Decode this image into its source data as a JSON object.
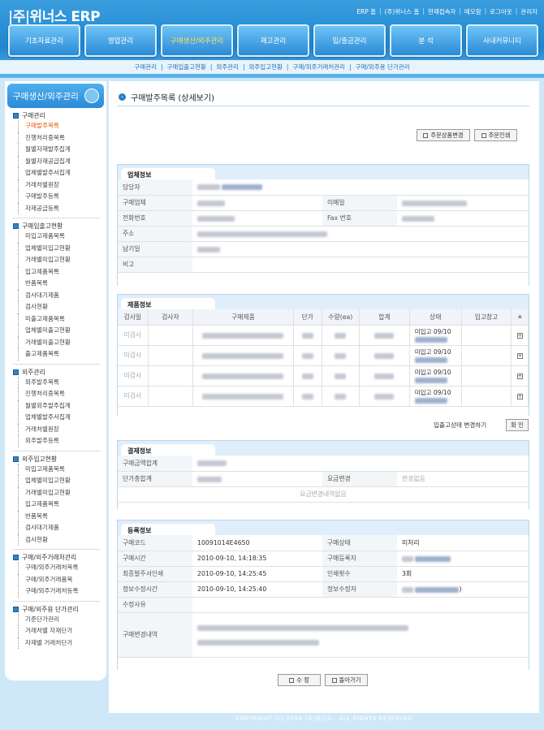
{
  "app": {
    "logo": "|주|위너스 ERP"
  },
  "toplinks": [
    "ERP 홈",
    "(주)위너스 홈",
    "현재접속자",
    "메모함",
    "로그아웃",
    "관리자"
  ],
  "nav": [
    "기초자료관리",
    "영업관리",
    "구매생산/외주관리",
    "재고관리",
    "입/출금관리",
    "분 석",
    "사내커뮤니티"
  ],
  "subnav": [
    "구매관리",
    "구매입출고현황",
    "외주관리",
    "외주입고현황",
    "구매/외주거래처관리",
    "구매/외주용 단가관리"
  ],
  "side": {
    "title": "구매생산/외주관리",
    "sections": [
      {
        "label": "구매관리",
        "items": [
          "구매발주목록",
          "진행처리중목록",
          "월별자재발주집계",
          "월별자재공급집계",
          "업체별발주서집계",
          "거래처별원장",
          "구매발주등록",
          "자재공급등록"
        ]
      },
      {
        "label": "구매입출고현황",
        "items": [
          "미입고제품목록",
          "업체별미입고현황",
          "거래별미입고현황",
          "입고제품목록",
          "반품목록",
          "검사대기제품",
          "검사현황",
          "미출고제품목록",
          "업체별미출고현황",
          "거래별미출고현황",
          "출고제품목록"
        ]
      },
      {
        "label": "외주관리",
        "items": [
          "외주발주목록",
          "진행처리중목록",
          "월별외주발주집계",
          "업체별발주서집계",
          "거래처별원장",
          "외주발주등록"
        ]
      },
      {
        "label": "외주입고현황",
        "items": [
          "미입고제품목록",
          "업체별미입고현황",
          "거래별미입고현황",
          "입고제품목록",
          "반품목록",
          "검사대기제품",
          "검사현황"
        ]
      },
      {
        "label": "구매/외주거래처관리",
        "items": [
          "구매/외주거래처목록",
          "구매/외주거래품목",
          "구매/외주거래처등록"
        ]
      },
      {
        "label": "구매/외주용 단가관리",
        "items": [
          "기준단가관리",
          "거래처별 자재단가",
          "자재별 거래처단가"
        ]
      }
    ]
  },
  "page": {
    "title": "구매발주목록 (상세보기)",
    "btn_change": "주문상품변경",
    "btn_print": "주문인쇄",
    "company": {
      "header": "업체정보",
      "labels": [
        "담당자",
        "구매업체",
        "이메일",
        "전화번호",
        "Fax 번호",
        "주소",
        "납기일",
        "비고"
      ]
    },
    "product": {
      "header": "제품정보",
      "cols": [
        "검사일",
        "검사자",
        "구매제품",
        "단가",
        "수량(ea)",
        "합계",
        "상태",
        "입고창고"
      ],
      "rows": [
        {
          "check": "미검사",
          "state": "미입고 09/10"
        },
        {
          "check": "미검사",
          "state": "미입고 09/10"
        },
        {
          "check": "미검사",
          "state": "미입고 09/10"
        },
        {
          "check": "미검사",
          "state": "미입고 09/10"
        }
      ],
      "footer_text": "입출고상태 변경하기",
      "confirm": "확 인"
    },
    "payment": {
      "header": "결제정보",
      "labels": [
        "구매금액합계",
        "단가총합계",
        "요금변경"
      ],
      "change_value": "변경없음",
      "history": "요금변경내역없음"
    },
    "reg": {
      "header": "등록정보",
      "code_label": "구매코드",
      "code": "10091014E4650",
      "status_label": "구매상태",
      "status": "미처리",
      "time_label": "구매시간",
      "time": "2010-09-10, 14:18:35",
      "registrant_label": "구매등록자",
      "last_label": "최종발주서인쇄",
      "last": "2010-09-10, 14:25:45",
      "count_label": "인쇄횟수",
      "count": "3회",
      "mod_label": "정보수정시간",
      "mod": "2010-09-10, 14:25:40",
      "modifier_label": "정보수정자",
      "modifier_suffix": ")",
      "reason_label": "수정사유",
      "history_label": "구매변경내역"
    },
    "btn_edit": "수   정",
    "btn_back": "돌아가기"
  },
  "footer": "COPYRIGHT (C) 2010 (주)위너스 . ALL RIGHTS RESERVED"
}
